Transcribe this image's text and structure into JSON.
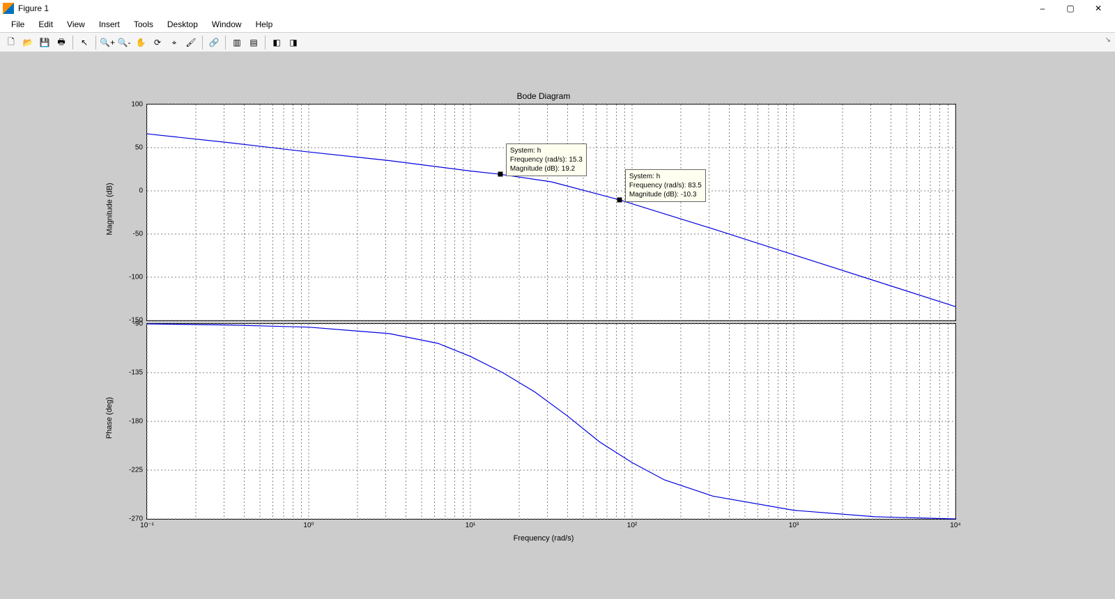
{
  "window": {
    "title": "Figure 1",
    "min_tip": "–",
    "max_tip": "▢",
    "close_tip": "✕",
    "rt_toggle": "↘"
  },
  "menu": {
    "file": "File",
    "edit": "Edit",
    "view": "View",
    "insert": "Insert",
    "tools": "Tools",
    "desktop": "Desktop",
    "window": "Window",
    "help": "Help"
  },
  "toolbar_icons": {
    "new": "🗋",
    "open": "📂",
    "save": "💾",
    "print": "🖶",
    "pointer": "↖",
    "zoomin": "🔍+",
    "zoomout": "🔍-",
    "pan": "✋",
    "rotate": "⟳",
    "datacursor": "⌖",
    "brush": "🖌",
    "link": "🔗",
    "colorbar": "▥",
    "legend": "▤",
    "dock": "◧",
    "undock": "◨"
  },
  "chart_data": {
    "title": "Bode Diagram",
    "xlabel": "Frequency  (rad/s)",
    "magnitude": {
      "ylabel": "Magnitude (dB)",
      "ylim": [
        -150,
        100
      ],
      "yticks": [
        -150,
        -100,
        -50,
        0,
        50,
        100
      ]
    },
    "phase": {
      "ylabel": "Phase (deg)",
      "ylim": [
        -270,
        -90
      ],
      "yticks": [
        -270,
        -225,
        -180,
        -135,
        -90
      ]
    },
    "xlim_log10": [
      -1,
      4
    ],
    "xticks_log10": [
      -1,
      0,
      1,
      2,
      3,
      4
    ],
    "xtick_labels": [
      "10⁻¹",
      "10⁰",
      "10¹",
      "10²",
      "10³",
      "10⁴"
    ],
    "datatips": [
      {
        "system_label": "System: h",
        "freq_label": "Frequency (rad/s): 15.3",
        "mag_label": "Magnitude (dB): 19.2",
        "freq": 15.3,
        "mag": 19.2
      },
      {
        "system_label": "System: h",
        "freq_label": "Frequency (rad/s): 83.5",
        "mag_label": "Magnitude (dB): -10.3",
        "freq": 83.5,
        "mag": -10.3
      }
    ],
    "type": "line",
    "series": [
      {
        "name": "Magnitude (dB)",
        "x_log10": [
          -1.0,
          -0.5,
          0.0,
          0.5,
          1.0,
          1.184,
          1.5,
          1.921,
          2.0,
          2.5,
          3.0,
          3.5,
          4.0
        ],
        "values": [
          66,
          56,
          45,
          35,
          23,
          19.2,
          10.5,
          -10.3,
          -15,
          -44,
          -74,
          -104,
          -134
        ]
      },
      {
        "name": "Phase (deg)",
        "x_log10": [
          -1.0,
          -0.5,
          0.0,
          0.5,
          0.8,
          1.0,
          1.2,
          1.4,
          1.6,
          1.8,
          2.0,
          2.2,
          2.5,
          3.0,
          3.5,
          4.0
        ],
        "values": [
          -90,
          -91,
          -93,
          -99,
          -108,
          -120,
          -135,
          -153,
          -175,
          -199,
          -218,
          -234,
          -249,
          -262,
          -268,
          -270
        ]
      }
    ]
  }
}
